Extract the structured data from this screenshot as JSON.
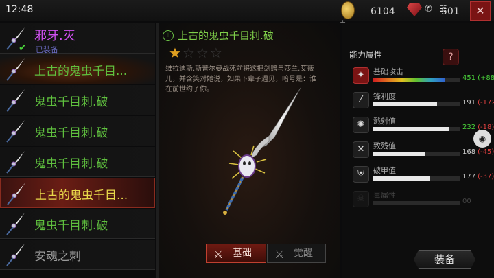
{
  "status": {
    "time": "12:48",
    "icons": "✱ ✆ ☷",
    "battery": "79"
  },
  "currency": {
    "coins": "6104",
    "coins_plus": "+",
    "gems": "501"
  },
  "list": [
    {
      "label": "邪牙.灭",
      "sub": "已装备",
      "style": "purple",
      "equipped": true
    },
    {
      "label": "上古的鬼虫千目...",
      "style": "green"
    },
    {
      "label": "鬼虫千目刺.破",
      "style": "green"
    },
    {
      "label": "鬼虫千目刺.破",
      "style": "green"
    },
    {
      "label": "鬼虫千目刺.破",
      "style": "green"
    },
    {
      "label": "上古的鬼虫千目...",
      "style": "yellow",
      "selected": true
    },
    {
      "label": "鬼虫千目刺.破",
      "style": "green"
    },
    {
      "label": "安魂之刺",
      "style": "gray"
    }
  ],
  "detail": {
    "title": "上古的鬼虫千目刺.破",
    "stars_filled": 1,
    "stars_total": 4,
    "description": "维拉迪斯.斯普尔曼战死前将这把剑赠与莎兰.艾薇儿，并含笑对她说，如果下辈子遇见，暗号是：谁在前世约了你。"
  },
  "tabs": {
    "basic": "基础",
    "awaken": "觉醒"
  },
  "attributes_title": "能力属性",
  "attributes": [
    {
      "name": "基础攻击",
      "value": "451",
      "delta": "(+88)",
      "delta_sign": "pos",
      "level": 0.83,
      "rainbow": true,
      "icon": "sword-icon"
    },
    {
      "name": "锋利度",
      "value": "191",
      "delta": "(-172)",
      "delta_sign": "neg",
      "level": 0.74,
      "icon": "slash-icon"
    },
    {
      "name": "溅射值",
      "value": "232",
      "delta": "(-18)",
      "delta_sign": "pos",
      "level": 0.87,
      "icon": "splash-icon"
    },
    {
      "name": "致残值",
      "value": "168",
      "delta": "(-45)",
      "delta_sign": "neg",
      "level": 0.6,
      "icon": "cripple-icon"
    },
    {
      "name": "破甲值",
      "value": "177",
      "delta": "(-37)",
      "delta_sign": "neg",
      "level": 0.65,
      "icon": "shield-icon"
    },
    {
      "name": "毒属性",
      "value": "00",
      "delta": "",
      "delta_sign": "",
      "level": 0,
      "dim": true,
      "icon": "skull-icon"
    }
  ],
  "equip_label": "装备",
  "help_label": "?",
  "close_label": "✕"
}
